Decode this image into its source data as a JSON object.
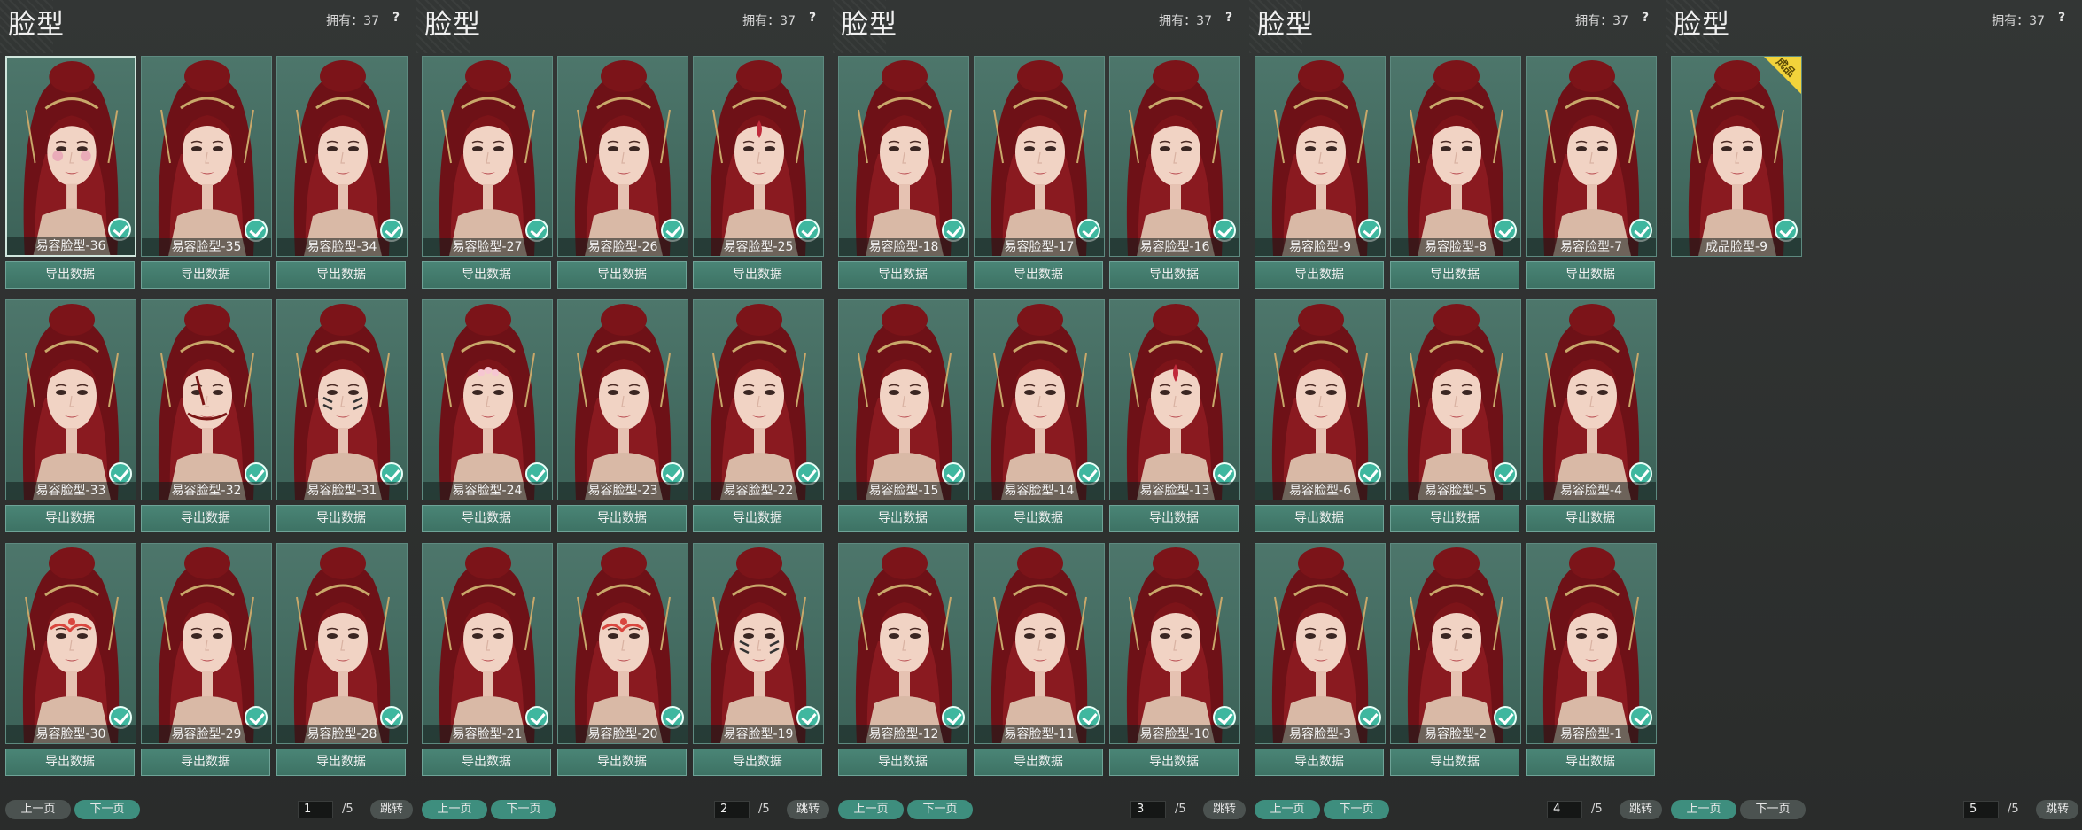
{
  "ui": {
    "title": "脸型",
    "owned_label": "拥有：37",
    "help_label": "?",
    "export_label": "导出数据",
    "prev_label": "上一页",
    "next_label": "下一页",
    "jump_label": "跳转",
    "total_pages": "/5"
  },
  "colors": {
    "accent": "#3e8e7e",
    "card_bg": "#44695f",
    "check": "#3fb79f",
    "badge": "#f2d33b"
  },
  "pages": [
    {
      "page": "1",
      "items": [
        {
          "label": "易容脸型-36",
          "owned": true,
          "selected": true,
          "makeup": "pink-cheek"
        },
        {
          "label": "易容脸型-35",
          "owned": true
        },
        {
          "label": "易容脸型-34",
          "owned": true
        },
        {
          "label": "易容脸型-33",
          "owned": true
        },
        {
          "label": "易容脸型-32",
          "owned": true,
          "makeup": "scar"
        },
        {
          "label": "易容脸型-31",
          "owned": true,
          "makeup": "stripes"
        },
        {
          "label": "易容脸型-30",
          "owned": true,
          "makeup": "red-pattern"
        },
        {
          "label": "易容脸型-29",
          "owned": true
        },
        {
          "label": "易容脸型-28",
          "owned": true
        }
      ]
    },
    {
      "page": "2",
      "items": [
        {
          "label": "易容脸型-27",
          "owned": true
        },
        {
          "label": "易容脸型-26",
          "owned": true
        },
        {
          "label": "易容脸型-25",
          "owned": true,
          "makeup": "forehead-mark"
        },
        {
          "label": "易容脸型-24",
          "owned": true,
          "makeup": "forehead-flower"
        },
        {
          "label": "易容脸型-23",
          "owned": true
        },
        {
          "label": "易容脸型-22",
          "owned": true
        },
        {
          "label": "易容脸型-21",
          "owned": true
        },
        {
          "label": "易容脸型-20",
          "owned": true,
          "makeup": "red-pattern"
        },
        {
          "label": "易容脸型-19",
          "owned": true,
          "makeup": "stripes"
        }
      ]
    },
    {
      "page": "3",
      "items": [
        {
          "label": "易容脸型-18",
          "owned": true
        },
        {
          "label": "易容脸型-17",
          "owned": true
        },
        {
          "label": "易容脸型-16",
          "owned": true
        },
        {
          "label": "易容脸型-15",
          "owned": true
        },
        {
          "label": "易容脸型-14",
          "owned": true
        },
        {
          "label": "易容脸型-13",
          "owned": true,
          "makeup": "forehead-mark"
        },
        {
          "label": "易容脸型-12",
          "owned": true
        },
        {
          "label": "易容脸型-11",
          "owned": true
        },
        {
          "label": "易容脸型-10",
          "owned": true
        }
      ]
    },
    {
      "page": "4",
      "items": [
        {
          "label": "易容脸型-9",
          "owned": true
        },
        {
          "label": "易容脸型-8",
          "owned": true
        },
        {
          "label": "易容脸型-7",
          "owned": true
        },
        {
          "label": "易容脸型-6",
          "owned": true
        },
        {
          "label": "易容脸型-5",
          "owned": true
        },
        {
          "label": "易容脸型-4",
          "owned": true
        },
        {
          "label": "易容脸型-3",
          "owned": true
        },
        {
          "label": "易容脸型-2",
          "owned": true
        },
        {
          "label": "易容脸型-1",
          "owned": true
        }
      ]
    },
    {
      "page": "5",
      "items": [
        {
          "label": "成品脸型-9",
          "owned": true,
          "badge": "成品"
        }
      ]
    }
  ]
}
